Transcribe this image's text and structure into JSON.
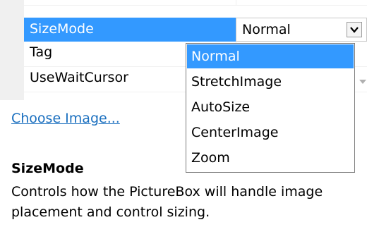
{
  "grid": {
    "partial_row": {
      "name": "",
      "value": ""
    },
    "rows": [
      {
        "name": "SizeMode",
        "value": "Normal",
        "selected": true
      },
      {
        "name": "Tag",
        "value": ""
      },
      {
        "name": "UseWaitCursor",
        "value": ""
      }
    ],
    "dropdown_icon": "chevron-down-icon"
  },
  "dropdown": {
    "options": [
      "Normal",
      "StretchImage",
      "AutoSize",
      "CenterImage",
      "Zoom"
    ],
    "selected_index": 0
  },
  "link": {
    "label": "Choose Image..."
  },
  "description": {
    "title": "SizeMode",
    "text": "Controls how the PictureBox will handle image placement and control sizing."
  },
  "colors": {
    "selection": "#3399ff",
    "link": "#1a6fbf",
    "gutter": "#f0f0f0"
  }
}
